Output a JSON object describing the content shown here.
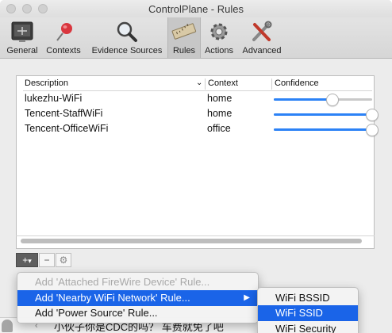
{
  "window": {
    "title": "ControlPlane - Rules"
  },
  "toolbar": {
    "items": [
      {
        "label": "General",
        "icon": "general-icon"
      },
      {
        "label": "Contexts",
        "icon": "pushpin-icon"
      },
      {
        "label": "Evidence Sources",
        "icon": "magnifier-icon"
      },
      {
        "label": "Rules",
        "icon": "ruler-icon",
        "selected": true
      },
      {
        "label": "Actions",
        "icon": "gear-icon"
      },
      {
        "label": "Advanced",
        "icon": "tools-icon"
      }
    ]
  },
  "table": {
    "columns": [
      "Description",
      "Context",
      "Confidence"
    ],
    "rows": [
      {
        "description": "lukezhu-WiFi",
        "context": "home",
        "confidence": 0.6
      },
      {
        "description": "Tencent-StaffWiFi",
        "context": "home",
        "confidence": 1.0
      },
      {
        "description": "Tencent-OfficeWiFi",
        "context": "office",
        "confidence": 1.0
      }
    ]
  },
  "buttons": {
    "add": "+",
    "add_arrow": "▾",
    "remove": "−",
    "action_icon": "gear-icon"
  },
  "menu": {
    "items": [
      {
        "label": "Add 'Attached FireWire Device' Rule...",
        "disabled": true
      },
      {
        "label": "Add 'Nearby WiFi Network' Rule...",
        "highlighted": true,
        "submenu": "▶"
      },
      {
        "label": "Add 'Power Source' Rule..."
      }
    ]
  },
  "submenu": {
    "items": [
      {
        "label": "WiFi BSSID"
      },
      {
        "label": "WiFi SSID",
        "highlighted": true
      },
      {
        "label": "WiFi Security"
      }
    ]
  },
  "background": {
    "chat_text": "小伙子你是CDC的吗？ 车费就免了吧"
  },
  "colors": {
    "accent": "#1a64e8",
    "slider": "#2c82f6"
  }
}
